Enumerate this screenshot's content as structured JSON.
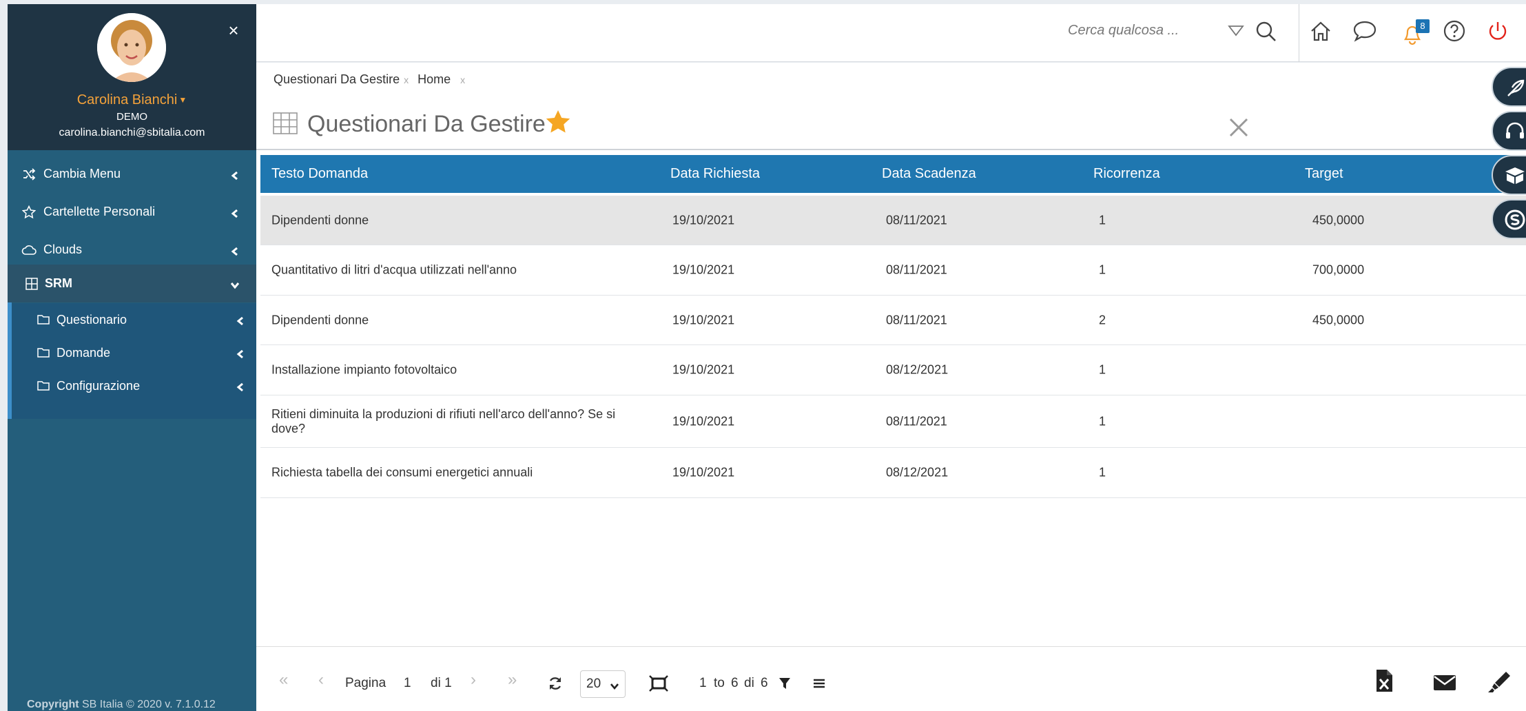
{
  "sidebar": {
    "close_label": "×",
    "user": {
      "name": "Carolina Bianchi",
      "role": "DEMO",
      "email": "carolina.bianchi@sbitalia.com"
    },
    "items": [
      {
        "label": "Cambia Menu",
        "icon": "shuffle-icon"
      },
      {
        "label": "Cartellette Personali",
        "icon": "star-outline-icon"
      },
      {
        "label": "Clouds",
        "icon": "cloud-icon"
      },
      {
        "label": "SRM",
        "icon": "grid-icon"
      }
    ],
    "subitems": [
      {
        "label": "Questionario",
        "icon": "folder-icon"
      },
      {
        "label": "Domande",
        "icon": "folder-icon"
      },
      {
        "label": "Configurazione",
        "icon": "folder-icon"
      }
    ],
    "copyright_bold": "Copyright",
    "copyright_rest": " SB Italia © 2020 v. 7.1.0.12"
  },
  "topbar": {
    "search_placeholder": "Cerca qualcosa ...",
    "notifications_count": "8",
    "icons": [
      "home-icon",
      "chat-icon",
      "bell-icon",
      "help-icon",
      "power-icon"
    ],
    "accent_power": "#e2231a",
    "accent_bell": "#f29a2e"
  },
  "breadcrumbs": [
    {
      "label": "Questionari Da Gestire",
      "close": "x"
    },
    {
      "label": "Home",
      "close": "x"
    }
  ],
  "page": {
    "title": "Questionari Da Gestire",
    "star_color": "#f5a623"
  },
  "table": {
    "columns": [
      "Testo Domanda",
      "Data Richiesta",
      "Data Scadenza",
      "Ricorrenza",
      "Target"
    ],
    "rows": [
      [
        "Dipendenti donne",
        "19/10/2021",
        "08/11/2021",
        "1",
        "450,0000"
      ],
      [
        "Quantitativo di litri d'acqua utilizzati nell'anno",
        "19/10/2021",
        "08/11/2021",
        "1",
        "700,0000"
      ],
      [
        "Dipendenti donne",
        "19/10/2021",
        "08/11/2021",
        "2",
        "450,0000"
      ],
      [
        "Installazione impianto fotovoltaico",
        "19/10/2021",
        "08/12/2021",
        "1",
        ""
      ],
      [
        "Ritieni diminuita la produzioni di rifiuti nell'arco dell'anno? Se si dove?",
        "19/10/2021",
        "08/11/2021",
        "1",
        ""
      ],
      [
        "Richiesta tabella dei consumi energetici annuali",
        "19/10/2021",
        "08/12/2021",
        "1",
        ""
      ]
    ],
    "header_color": "#1f77b0"
  },
  "pager": {
    "first": "«",
    "prev": "‹",
    "page_label": "Pagina",
    "page_value": "1",
    "of_label": "di 1",
    "next": "›",
    "last": "»",
    "page_size": "20",
    "range_start": "1",
    "range_to": "to",
    "range_end": "6",
    "range_of": "di",
    "range_total": "6"
  }
}
